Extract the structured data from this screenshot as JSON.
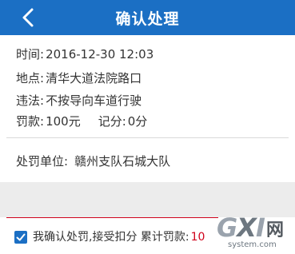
{
  "header": {
    "title": "确认处理",
    "back_icon": "chevron-left-icon",
    "background": "#1b6fc4"
  },
  "violation": {
    "time_label": "时间:",
    "time_value": "2016-12-30 12:03",
    "location_label": "地点:",
    "location_value": "清华大道法院路口",
    "violation_label": "违法:",
    "violation_value": "不按导向车道行驶",
    "fine_label": "罚款:",
    "fine_value": "100元",
    "points_label": "记分:",
    "points_value": "0分"
  },
  "penalty_unit": {
    "label": "处罚单位:",
    "value": "赣州支队石城大队"
  },
  "confirm": {
    "checked": true,
    "text": "我确认处罚,接受扣分 累计罚款:",
    "amount": "10"
  },
  "watermark": {
    "letters_g": "G",
    "letters_x": "X",
    "letters_i": "I",
    "han": "网",
    "url": "system.com"
  },
  "colors": {
    "accent": "#1b6fc4",
    "highlight_red": "#d0021b"
  }
}
